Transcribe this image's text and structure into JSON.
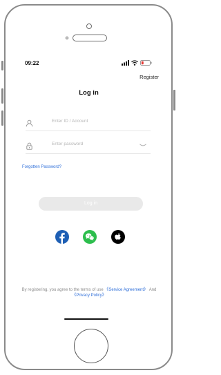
{
  "status_bar": {
    "time": "09:22",
    "icons": [
      "signal-icon",
      "wifi-icon",
      "battery-icon"
    ],
    "battery_color": "#e53935"
  },
  "header": {
    "register_label": "Register"
  },
  "page": {
    "title": "Log in"
  },
  "form": {
    "account_placeholder": "Enter ID / Account",
    "account_value": "",
    "password_placeholder": "Enter password",
    "password_value": "",
    "forgot_label": "Forgotten Password?",
    "submit_label": "Log in"
  },
  "social": [
    {
      "name": "facebook-icon",
      "color": "#1e5fb4"
    },
    {
      "name": "wechat-icon",
      "color": "#2dbe4d"
    },
    {
      "name": "apple-icon",
      "color": "#000000"
    }
  ],
  "terms": {
    "prefix": "By registering, you agree to the terms of use ",
    "service_link": "《Service Agreement》",
    "middle": " And ",
    "privacy_link": "《Privacy Policy》"
  },
  "colors": {
    "link": "#2f6fd9",
    "button_disabled": "#e9e9e9"
  }
}
